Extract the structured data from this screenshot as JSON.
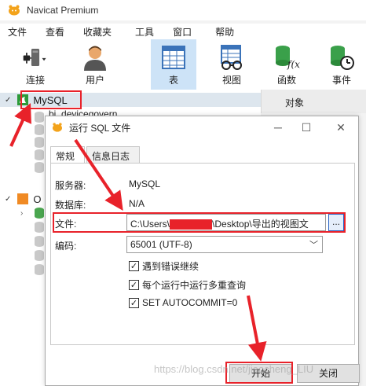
{
  "app": {
    "title": "Navicat Premium"
  },
  "menu": [
    "文件",
    "查看",
    "收藏夹",
    "工具",
    "窗口",
    "帮助"
  ],
  "toolbar": {
    "connect": "连接",
    "user": "用户",
    "table": "表",
    "view": "视图",
    "function": "函数",
    "event": "事件"
  },
  "tree": {
    "connection": "MySQL",
    "db_item": "bi_devicegovern",
    "second_conn_initial": "O"
  },
  "object_tab": "对象",
  "dialog": {
    "title": "运行 SQL 文件",
    "tabs": [
      "常规",
      "信息日志"
    ],
    "server_label": "服务器:",
    "server_value": "MySQL",
    "database_label": "数据库:",
    "database_value": "N/A",
    "file_label": "文件:",
    "file_prefix": "C:\\Users\\",
    "file_suffix": "\\Desktop\\导出的视图文",
    "browse": "...",
    "encoding_label": "编码:",
    "encoding_value": "65001 (UTF-8)",
    "checks": [
      {
        "label": "遇到错误继续",
        "checked": true
      },
      {
        "label": "每个运行中运行多重查询",
        "checked": true
      },
      {
        "label": "SET AUTOCOMMIT=0",
        "checked": true
      }
    ],
    "start_button": "开始",
    "close_button": "关闭"
  },
  "watermark": "https://blog.csdn.net/jiaocheng_LIU",
  "colors": {
    "annotation_red": "#e8222a",
    "active_tool": "#cde3f7",
    "mysql_green": "#2c9b3a"
  }
}
